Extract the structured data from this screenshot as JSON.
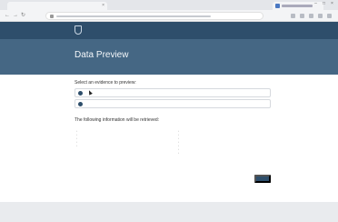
{
  "browser": {
    "tab_title": "",
    "tab2_title": "",
    "nav": {
      "back": "←",
      "forward": "→",
      "reload": "↻"
    },
    "url": ""
  },
  "app": {
    "logo_text": "",
    "user_name": "",
    "user_org": ""
  },
  "banner": {
    "title": "Data Preview"
  },
  "select_section": {
    "heading": "Select an evidence to preview:",
    "options": [
      "",
      ""
    ]
  },
  "info_section": {
    "heading": "The following information will be retrieved:",
    "left_column": {
      "heading": "",
      "items": [
        "",
        "",
        "",
        "",
        ""
      ]
    },
    "right_column": {
      "heading": "",
      "items": [
        "",
        "",
        "",
        "",
        "",
        "",
        ""
      ]
    }
  },
  "next_button": {
    "label": ""
  },
  "footer": {
    "text": ""
  },
  "colors": {
    "header": "#2e4e6b",
    "banner": "#456784",
    "accent": "#2e4e6b"
  }
}
